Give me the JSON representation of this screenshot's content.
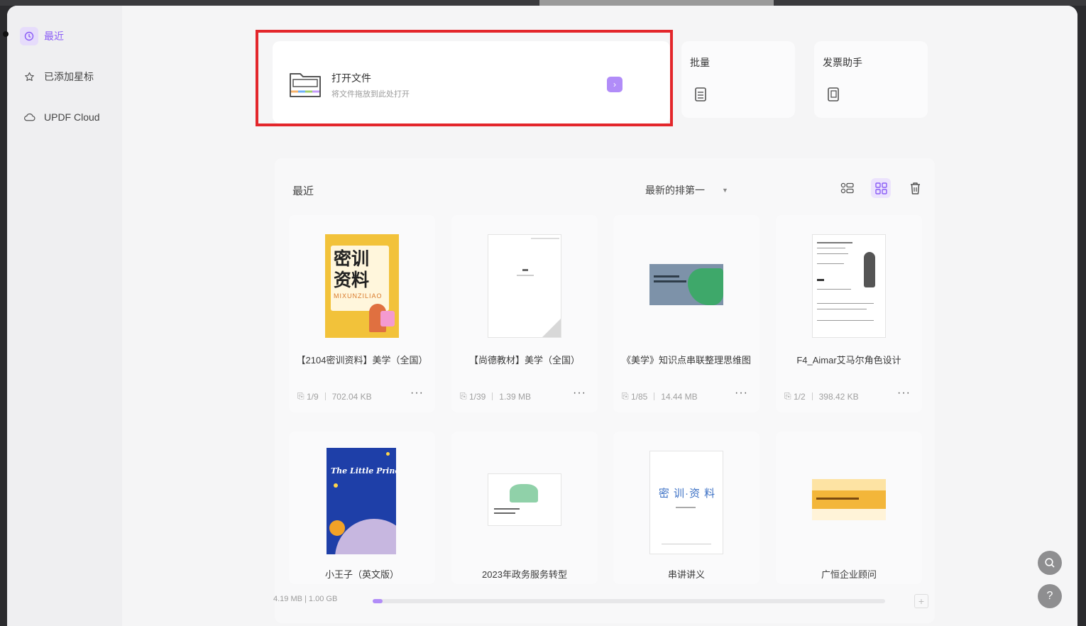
{
  "sidebar": {
    "items": [
      {
        "label": "最近",
        "icon": "clock-icon",
        "active": true
      },
      {
        "label": "已添加星标",
        "icon": "star-icon",
        "active": false
      },
      {
        "label": "UPDF Cloud",
        "icon": "cloud-icon",
        "active": false
      }
    ]
  },
  "quick": {
    "open_title": "打开文件",
    "open_sub": "将文件拖放到此处打开",
    "open_arrow": "›",
    "batch_label": "批量",
    "invoice_label": "发票助手"
  },
  "recent": {
    "title": "最近",
    "sort_label": "最新的排第一",
    "files": [
      {
        "name": "【2104密训资料】美学（全国）",
        "pages": "1/9",
        "size": "702.04 KB",
        "more": "···"
      },
      {
        "name": "【尚德教材】美学（全国）",
        "pages": "1/39",
        "size": "1.39 MB",
        "more": "···"
      },
      {
        "name": "《美学》知识点串联整理思维图",
        "pages": "1/85",
        "size": "14.44 MB",
        "more": "···"
      },
      {
        "name": "F4_Aimar艾马尔角色设计",
        "pages": "1/2",
        "size": "398.42 KB",
        "more": "···"
      },
      {
        "name": "小王子（英文版）"
      },
      {
        "name": "2023年政务服务转型"
      },
      {
        "name": "串讲讲义"
      },
      {
        "name": "广恒企业顾问"
      }
    ],
    "thumb_text": {
      "t1_a": "密训",
      "t1_b": "资料",
      "t1_c": "MIXUNZILIAO",
      "t5_title": "The Little Prince",
      "t7_title": "密 训·资 料"
    }
  },
  "storage": {
    "label": "4.19 MB | 1.00 GB",
    "used_fraction": 0.004
  },
  "colors": {
    "accent": "#8a5cf6",
    "highlight_box": "#e3262b"
  }
}
